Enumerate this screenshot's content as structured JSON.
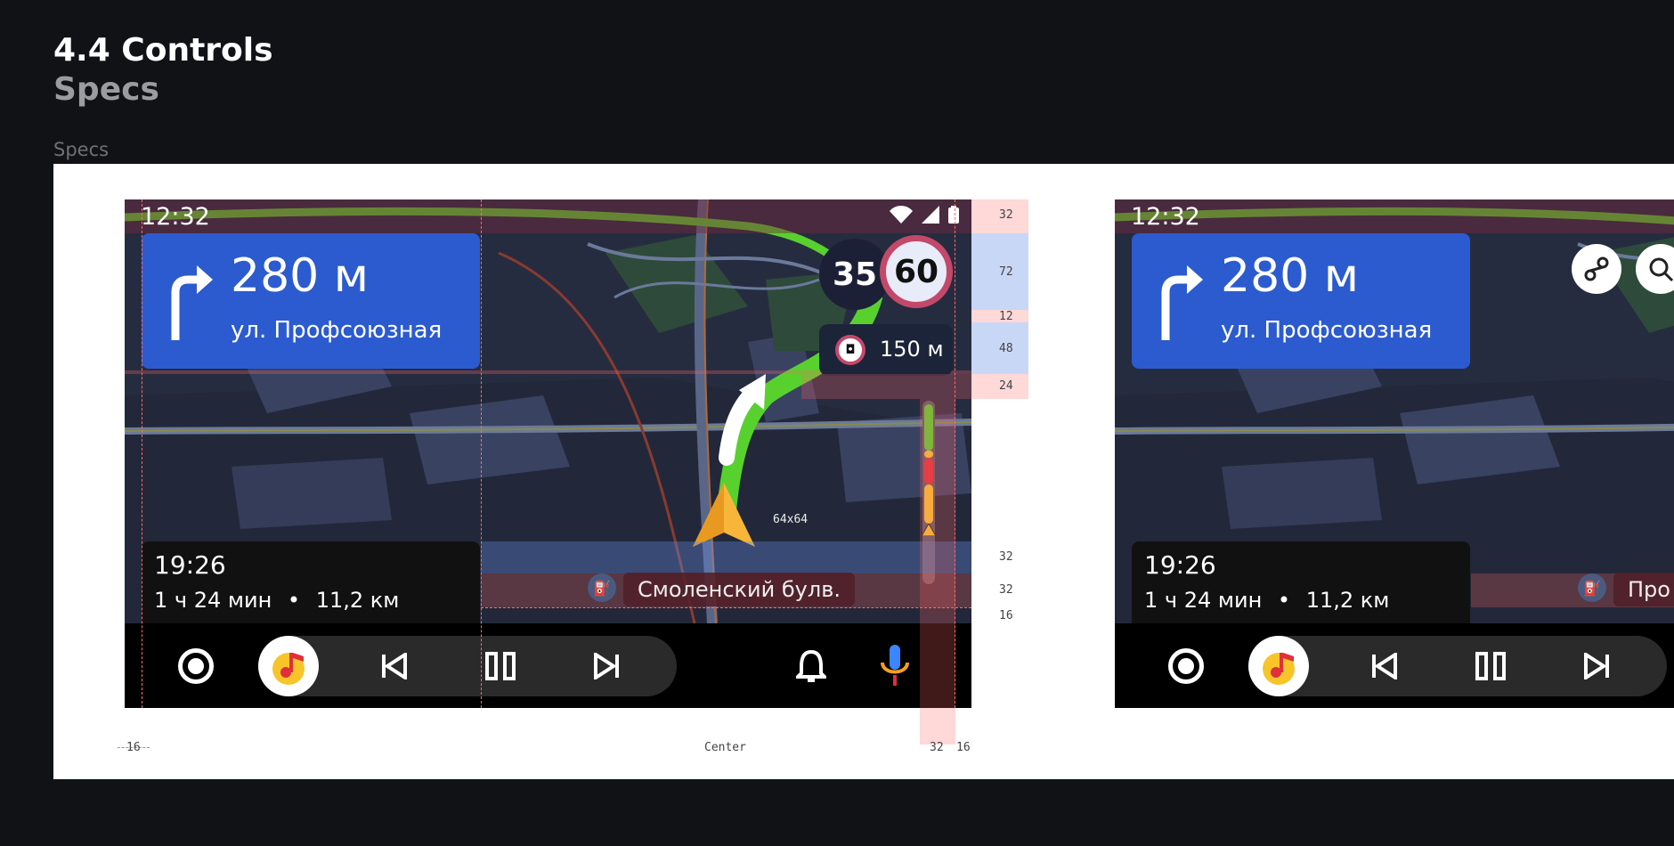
{
  "header": {
    "title": "4.4 Controls",
    "subtitle": "Specs",
    "caption": "Specs"
  },
  "screen1": {
    "clock": "12:32",
    "maneuver": {
      "distance": "280 м",
      "street": "ул. Профсоюзная"
    },
    "speed": {
      "current": "35",
      "limit": "60"
    },
    "camera": {
      "distance": "150 м"
    },
    "eta": {
      "arrival": "19:26",
      "duration": "1 ч 24 мин",
      "separator": "•",
      "distance": "11,2 км"
    },
    "street_label": "Смоленский булв.",
    "pointer_size": "64x64"
  },
  "screen2": {
    "clock": "12:32",
    "maneuver": {
      "distance": "280 м",
      "street": "ул. Профсоюзная"
    },
    "eta": {
      "arrival": "19:26",
      "duration": "1 ч 24 мин",
      "separator": "•",
      "distance": "11,2 км"
    },
    "street_label": "Про"
  },
  "specs": {
    "right": [
      "32",
      "72",
      "12",
      "48",
      "24",
      "32",
      "32",
      "16"
    ],
    "bottom_left": "16",
    "bottom_center": "Center",
    "bottom_right_a": "32",
    "bottom_right_b": "16"
  },
  "colors": {
    "route_green": "#58d12e",
    "maneuver_blue": "#2c5bcf",
    "limit_ring": "#c2496a",
    "spec_red": "#ff6b6b"
  }
}
